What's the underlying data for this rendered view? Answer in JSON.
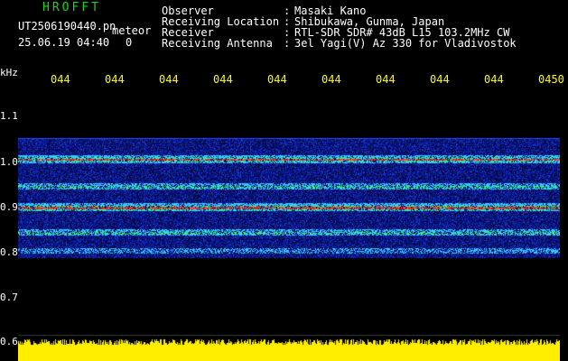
{
  "header": {
    "logo": "HROFFT",
    "file_name": "UT2506190440.pn",
    "meteor_label": "meteor",
    "date_time": "25.06.19 04:40",
    "count": "0",
    "fields": [
      {
        "label": "Observer",
        "value": "Masaki Kano"
      },
      {
        "label": "Receiving Location",
        "value": "Shibukawa, Gunma, Japan"
      },
      {
        "label": "Receiver",
        "value": "RTL-SDR SDR# 43dB L15 103.2MHz CW"
      },
      {
        "label": "Receiving Antenna",
        "value": "3el Yagi(V) Az 330 for Vladivostok"
      }
    ]
  },
  "axis": {
    "y_unit": "kHz",
    "y_ticks": [
      "1.1",
      "1.0",
      "0.9",
      "0.8",
      "0.7",
      "0.6"
    ],
    "time_ticks": [
      "044",
      "044",
      "044",
      "044",
      "044",
      "044",
      "044",
      "044",
      "044",
      "0450"
    ]
  },
  "colors": {
    "background": "#000000",
    "title_green": "#1ad61a",
    "tick_yellow": "#ffff00",
    "noise_blue": "#0a1a9c",
    "band_cyan": "#33ccff",
    "band_red": "#ff3322",
    "band_green": "#33ff66",
    "power_yellow": "#ffee00"
  },
  "spectrogram": {
    "freq_range_khz": [
      0.6,
      1.15
    ],
    "noise_floor_khz": [
      0.775,
      1.035
    ],
    "bands": [
      {
        "freq_khz": 0.99,
        "intensity": "high"
      },
      {
        "freq_khz": 0.93,
        "intensity": "medium"
      },
      {
        "freq_khz": 0.885,
        "intensity": "high"
      },
      {
        "freq_khz": 0.83,
        "intensity": "medium"
      },
      {
        "freq_khz": 0.79,
        "intensity": "low"
      }
    ]
  }
}
